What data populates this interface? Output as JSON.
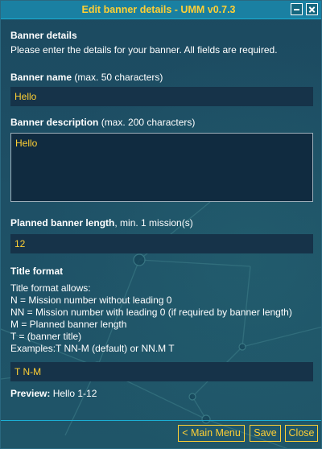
{
  "window": {
    "title": "Edit banner details - UMM v0.7.3",
    "minimize_icon": "minimize-icon",
    "close_icon": "close-icon"
  },
  "banner_details": {
    "heading": "Banner details",
    "intro": "Please enter the details for your banner. All fields are required."
  },
  "banner_name": {
    "label_bold": "Banner name",
    "label_rest": " (max. 50 characters)",
    "value": "Hello"
  },
  "banner_description": {
    "label_bold": "Banner description",
    "label_rest": " (max. 200 characters)",
    "value": "Hello"
  },
  "planned_length": {
    "label_bold": "Planned banner length",
    "label_rest": ", min. 1 mission(s)",
    "value": "12"
  },
  "title_format": {
    "heading": "Title format",
    "help_lines": [
      "Title format allows:",
      "N = Mission number without leading 0",
      "NN = Mission number with leading 0 (if required by banner length)",
      "M = Planned banner length",
      "T = (banner title)",
      "Examples:T NN-M (default) or NN.M T"
    ],
    "value": "T N-M"
  },
  "preview": {
    "label": "Preview:",
    "value": " Hello 1-12"
  },
  "footer": {
    "main_menu_label": "< Main Menu",
    "save_label": "Save",
    "close_label": "Close"
  },
  "colors": {
    "accent": "#ffcf34",
    "titlebar": "#1a80a2",
    "background": "#1e5066",
    "field": "#163349"
  }
}
